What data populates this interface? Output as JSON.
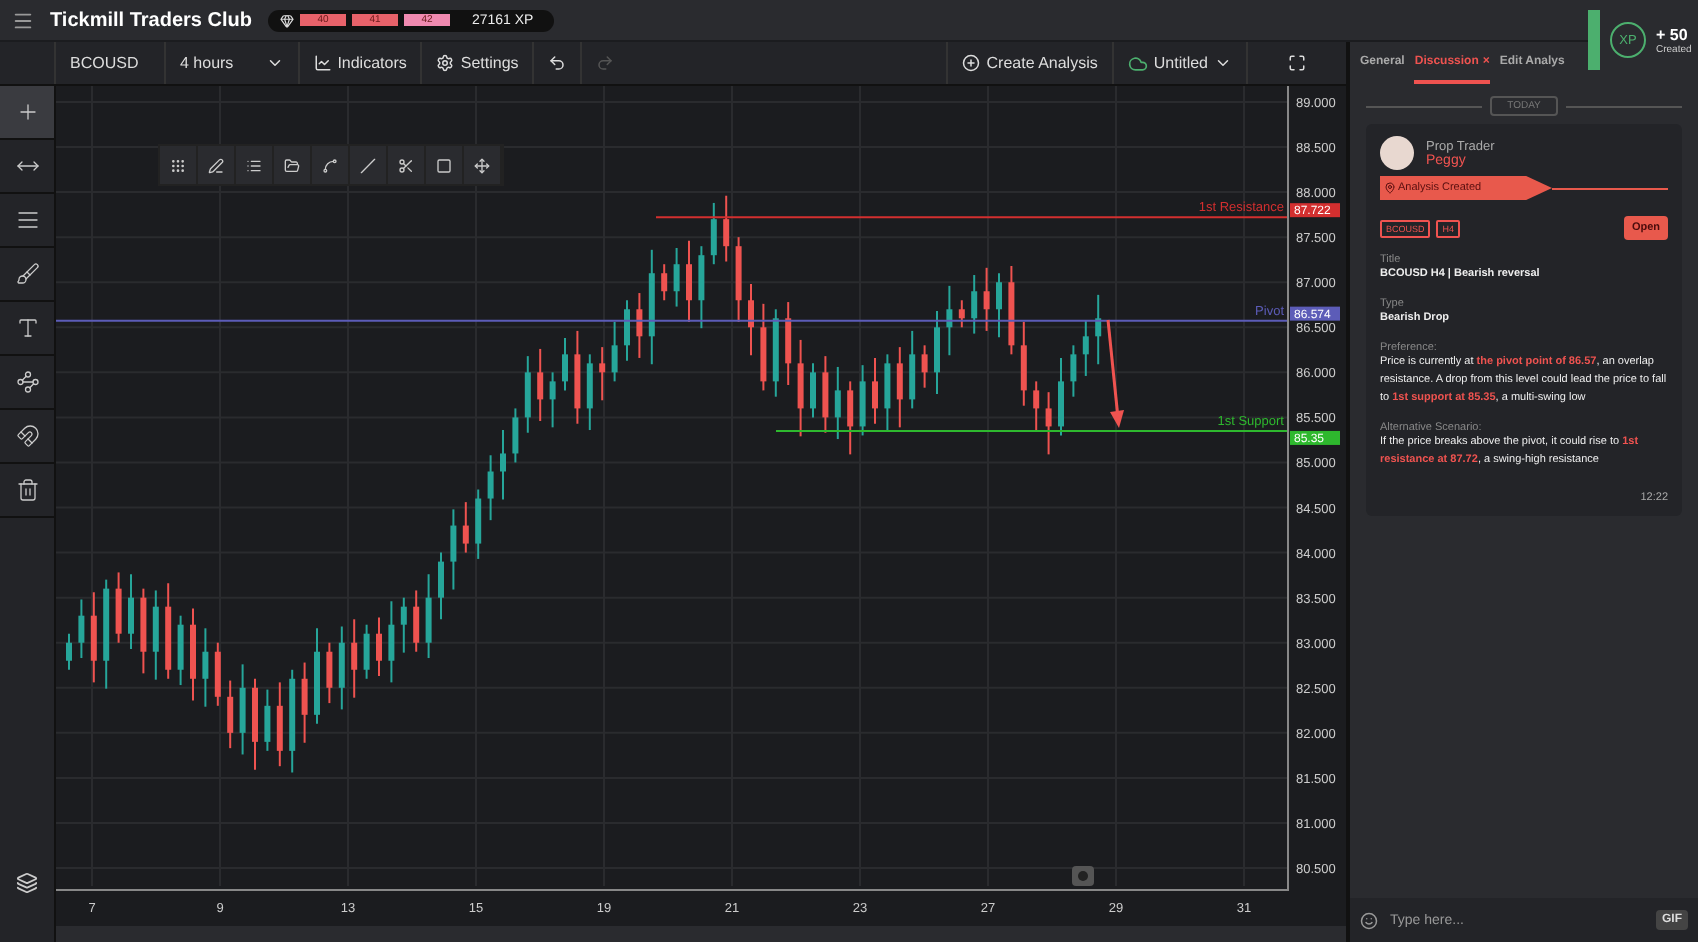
{
  "app": {
    "title": "Tickmill Traders Club",
    "levels": [
      {
        "label": "40",
        "color": "#e8626a"
      },
      {
        "label": "41",
        "color": "#e8626a"
      },
      {
        "label": "42",
        "color": "#f08ab0"
      }
    ],
    "xp": "27161 XP"
  },
  "toolbar": {
    "symbol": "BCOUSD",
    "interval": "4 hours",
    "indicators": "Indicators",
    "settings": "Settings",
    "create": "Create Analysis",
    "save_name": "Untitled"
  },
  "tools": [
    {
      "kind": "crosshair",
      "selected": true
    },
    {
      "kind": "hline",
      "selected": false
    },
    {
      "kind": "lines",
      "selected": false
    },
    {
      "kind": "brush",
      "selected": false
    },
    {
      "kind": "text",
      "selected": false
    },
    {
      "kind": "pattern",
      "selected": false
    },
    {
      "kind": "magnet",
      "selected": false
    },
    {
      "kind": "trash",
      "selected": false
    }
  ],
  "chart": {
    "price_ticks": [
      "89.000",
      "88.500",
      "88.000",
      "87.500",
      "87.000",
      "86.500",
      "86.000",
      "85.500",
      "85.000",
      "84.500",
      "84.000",
      "83.500",
      "83.000",
      "82.500",
      "82.000",
      "81.500",
      "81.000",
      "80.500"
    ],
    "date_ticks": [
      "7",
      "9",
      "13",
      "15",
      "19",
      "21",
      "23",
      "27",
      "29",
      "31"
    ],
    "levels": [
      {
        "kind": "resistance",
        "label": "1st Resistance",
        "price_label": "87.722",
        "color": "#d32f2f"
      },
      {
        "kind": "pivot",
        "label": "Pivot",
        "price_label": "86.574",
        "color": "#5c5cb8"
      },
      {
        "kind": "support",
        "label": "1st Support",
        "price_label": "85.35",
        "color": "#2eb82e"
      }
    ]
  },
  "panel": {
    "tabs": [
      {
        "label": "General",
        "selected": false
      },
      {
        "label": "Discussion",
        "selected": true,
        "close": "×"
      },
      {
        "label": "Edit Analys",
        "selected": false
      }
    ],
    "divider": "TODAY",
    "message": {
      "role": "Prop Trader",
      "name": "Peggy",
      "event": "Analysis Created",
      "tags": [
        "BCOUSD",
        "H4"
      ],
      "open": "Open",
      "fields": [
        {
          "label": "Title",
          "value": "BCOUSD H4 | Bearish reversal"
        },
        {
          "label": "Type",
          "value": "Bearish Drop"
        },
        {
          "label": "Preference:",
          "value": " Price is currently at **the pivot point of 86.57**, an overlap resistance. A drop from this level could lead the price to fall to **1st support at 85.35**, a multi-swing low"
        },
        {
          "label": "Alternative Scenario:",
          "value": " If the price breaks above the pivot, it could rise to **1st resistance at 87.72**, a swing-high resistance"
        }
      ],
      "time": "12:22"
    },
    "input": {
      "placeholder": "Type here..."
    },
    "gif": "GIF"
  },
  "notification": {
    "badge": "XP",
    "points": "+ 50",
    "caption": "Created"
  }
}
